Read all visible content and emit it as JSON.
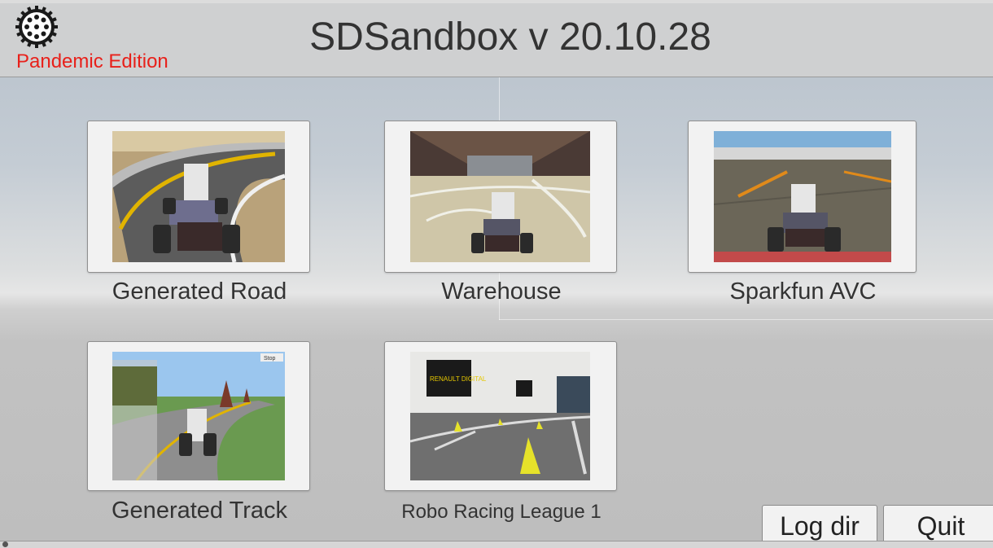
{
  "header": {
    "title": "SDSandbox v 20.10.28",
    "edition": "Pandemic Edition",
    "logo_icon": "gear-wheel-logo-icon",
    "edition_color": "#e8201a"
  },
  "scenes": [
    {
      "label": "Generated Road",
      "thumbnail": "generated-road-thumbnail"
    },
    {
      "label": "Warehouse",
      "thumbnail": "warehouse-thumbnail"
    },
    {
      "label": "Sparkfun AVC",
      "thumbnail": "sparkfun-avc-thumbnail"
    },
    {
      "label": "Generated Track",
      "thumbnail": "generated-track-thumbnail"
    },
    {
      "label": "Robo Racing League 1",
      "thumbnail": "robo-racing-league-thumbnail"
    }
  ],
  "thumb_text": {
    "renault_sign": "RENAULT DIGITAL",
    "track_stop": "Stop"
  },
  "buttons": {
    "log_dir": "Log dir",
    "quit": "Quit"
  }
}
